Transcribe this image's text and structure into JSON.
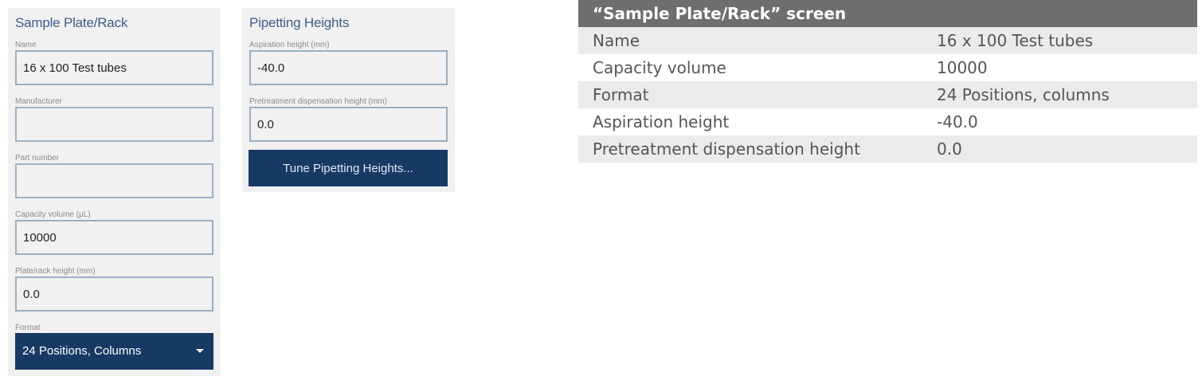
{
  "sample_panel": {
    "title": "Sample Plate/Rack",
    "fields": [
      {
        "label": "Name",
        "value": "16 x 100 Test tubes"
      },
      {
        "label": "Manufacturer",
        "value": ""
      },
      {
        "label": "Part number",
        "value": ""
      },
      {
        "label": "Capacity volume (µL)",
        "value": "10000"
      },
      {
        "label": "Plate/rack height (mm)",
        "value": "0.0"
      }
    ],
    "format": {
      "label": "Format",
      "value": "24 Positions, Columns"
    }
  },
  "pipetting_panel": {
    "title": "Pipetting Heights",
    "fields": [
      {
        "label": "Aspiration height (mm)",
        "value": "-40.0"
      },
      {
        "label": "Pretreatment dispensation height (mm)",
        "value": "0.0"
      }
    ],
    "tune_button_label": "Tune Pipetting Heights..."
  },
  "summary_table": {
    "header": "“Sample Plate/Rack” screen",
    "rows": [
      {
        "label": "Name",
        "value": "16 x 100 Test tubes"
      },
      {
        "label": "Capacity volume",
        "value": "10000"
      },
      {
        "label": "Format",
        "value": "24 Positions, columns"
      },
      {
        "label": "Aspiration height",
        "value": "-40.0"
      },
      {
        "label": "Pretreatment dispensation height",
        "value": "0.0"
      }
    ]
  },
  "colors": {
    "panel_background": "#f1f1f1",
    "title_blue": "#3a5f8c",
    "button_navy": "#163a63",
    "table_header_gray": "#6e6e6e",
    "table_row_shade": "#ebebeb"
  }
}
